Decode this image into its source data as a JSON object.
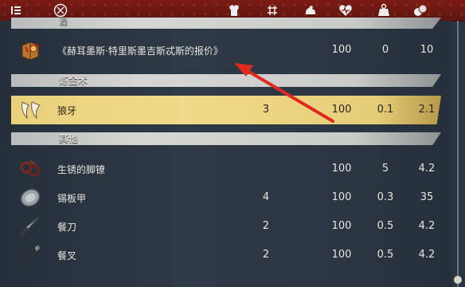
{
  "topbar": {
    "icons": [
      "menu-icon",
      "crest-icon",
      "armor-icon",
      "count-icon",
      "strength-icon",
      "hp-icon",
      "weight-icon",
      "value-icon"
    ]
  },
  "sections": [
    {
      "label": "酒"
    },
    {
      "label": "炼金术"
    },
    {
      "label": "其他"
    }
  ],
  "rows": [
    {
      "name": "《赫耳墨斯·特里斯墨吉斯忒斯的报价》",
      "count": "",
      "c1": "100",
      "c2": "0",
      "c3": "10",
      "selected": false,
      "icon": "book-icon"
    },
    {
      "name": "狼牙",
      "count": "3",
      "c1": "100",
      "c2": "0.1",
      "c3": "2.1",
      "selected": true,
      "icon": "fang-icon"
    },
    {
      "name": "生锈的脚镣",
      "count": "",
      "c1": "100",
      "c2": "5",
      "c3": "4.2",
      "selected": false,
      "icon": "shackles-icon"
    },
    {
      "name": "锡板甲",
      "count": "4",
      "c1": "100",
      "c2": "0.3",
      "c3": "35",
      "selected": false,
      "icon": "tin-plate-icon"
    },
    {
      "name": "餐刀",
      "count": "2",
      "c1": "100",
      "c2": "0.5",
      "c3": "4.2",
      "selected": false,
      "icon": "knife-icon"
    },
    {
      "name": "餐叉",
      "count": "2",
      "c1": "100",
      "c2": "0.5",
      "c3": "4.2",
      "selected": false,
      "icon": "fork-icon"
    }
  ],
  "colors": {
    "accent_red": "#7a1c14",
    "selected": "#f0d98a",
    "arrow": "#e0291f"
  }
}
